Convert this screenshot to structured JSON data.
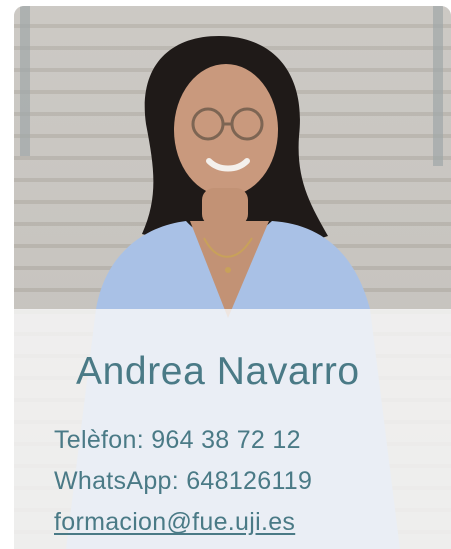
{
  "contact": {
    "name": "Andrea Navarro",
    "phone_line": "Telèfon: 964 38 72 12",
    "whatsapp_line": "WhatsApp: 648126119",
    "email": "formacion@fue.uji.es"
  },
  "colors": {
    "text": "#4a7a86",
    "overlay": "#f8f8f8"
  }
}
